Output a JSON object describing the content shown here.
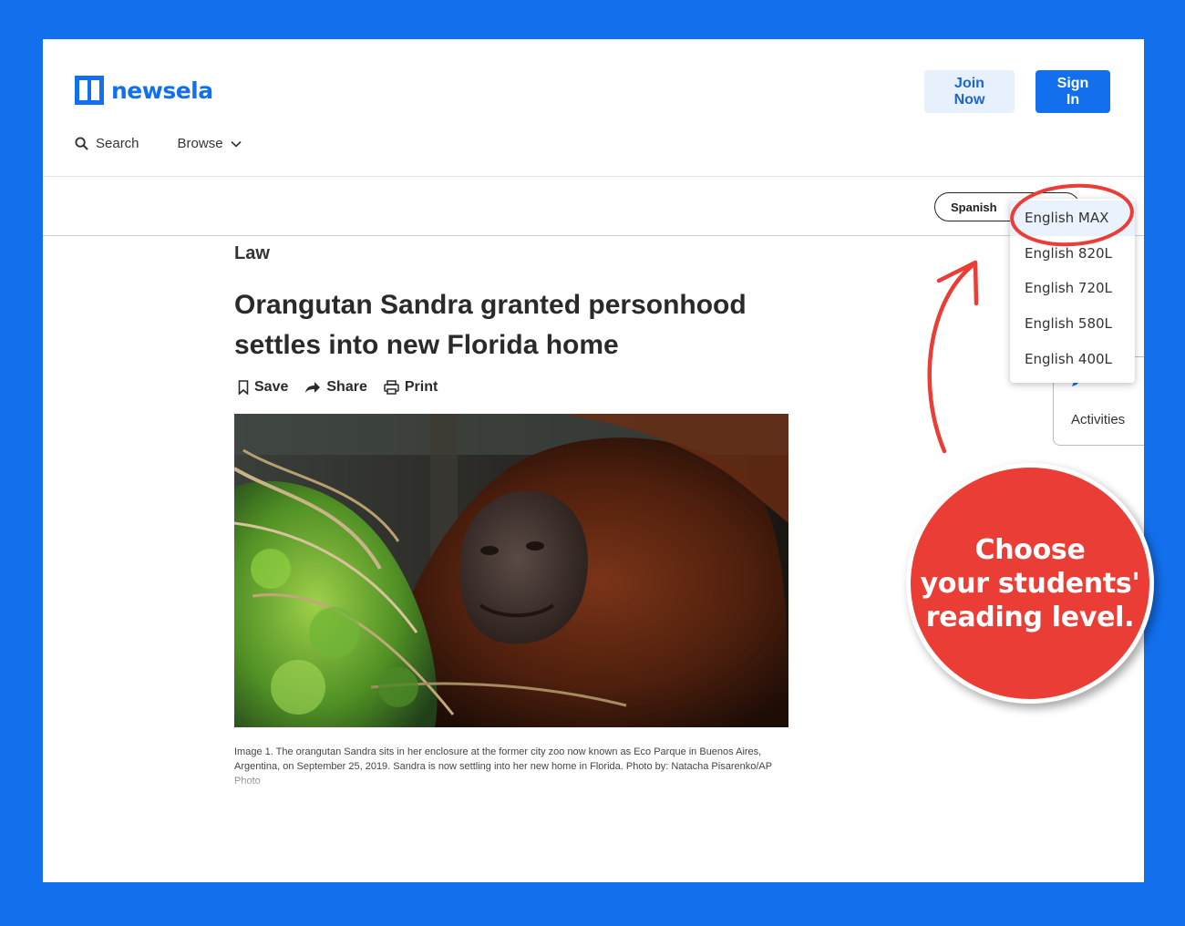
{
  "brand": {
    "name": "newsela",
    "color": "#1270ee"
  },
  "header": {
    "join_label": "Join Now",
    "signin_label": "Sign In"
  },
  "nav": {
    "search_label": "Search",
    "browse_label": "Browse"
  },
  "language_pill": {
    "label": "Spanish"
  },
  "dropdown": {
    "items": [
      "English MAX",
      "English 820L",
      "English 720L",
      "English 580L",
      "English 400L"
    ],
    "selected": "English MAX"
  },
  "activities": {
    "label": "Activities"
  },
  "article": {
    "section": "Law",
    "title": "Orangutan Sandra granted personhood settles into new Florida home",
    "actions": {
      "save": "Save",
      "share": "Share",
      "print": "Print"
    },
    "caption": "Image 1. The orangutan Sandra sits in her enclosure at the former city zoo now known as Eco Parque in Buenos Aires, Argentina, on September 25, 2019. Sandra is now settling into her new home in Florida. Photo by: Natacha Pisarenko/AP Photo"
  },
  "callout": {
    "lines": [
      "Choose",
      "your students'",
      "reading level."
    ],
    "color": "#ea3d35"
  }
}
